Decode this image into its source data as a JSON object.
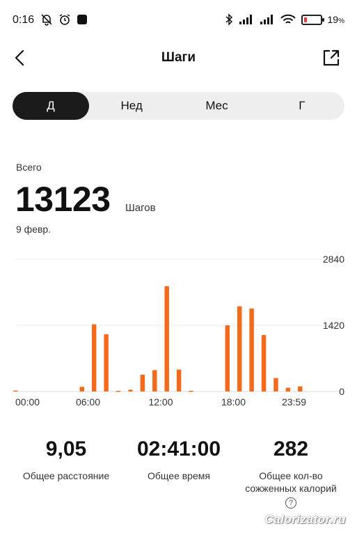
{
  "status_bar": {
    "time": "0:16",
    "battery_percent": "19",
    "battery_symbol": "%",
    "battery_level": 0.19
  },
  "header": {
    "title": "Шаги"
  },
  "tabs": [
    {
      "label": "Д",
      "active": true
    },
    {
      "label": "Нед",
      "active": false
    },
    {
      "label": "Мес",
      "active": false
    },
    {
      "label": "Г",
      "active": false
    }
  ],
  "summary": {
    "total_label": "Всего",
    "total_value": "13123",
    "unit": "Шагов",
    "date": "9 февр."
  },
  "chart_data": {
    "type": "bar",
    "x_tick_labels": [
      "00:00",
      "06:00",
      "12:00",
      "18:00",
      "23:59"
    ],
    "y_tick_labels": [
      "2840",
      "1420",
      "0"
    ],
    "ylim": [
      0,
      2840
    ],
    "grid": true,
    "color": "#f26b1d",
    "bars": [
      {
        "hour": 0,
        "value": 20
      },
      {
        "hour": 5.5,
        "value": 100
      },
      {
        "hour": 6.5,
        "value": 1440
      },
      {
        "hour": 7.5,
        "value": 1230
      },
      {
        "hour": 8.5,
        "value": 15
      },
      {
        "hour": 9.5,
        "value": 40
      },
      {
        "hour": 10.5,
        "value": 360
      },
      {
        "hour": 11.5,
        "value": 460
      },
      {
        "hour": 12.5,
        "value": 2260
      },
      {
        "hour": 13.5,
        "value": 470
      },
      {
        "hour": 14.5,
        "value": 15
      },
      {
        "hour": 17.5,
        "value": 1420
      },
      {
        "hour": 18.5,
        "value": 1830
      },
      {
        "hour": 19.5,
        "value": 1780
      },
      {
        "hour": 20.5,
        "value": 1210
      },
      {
        "hour": 21.5,
        "value": 290
      },
      {
        "hour": 22.5,
        "value": 80
      },
      {
        "hour": 23.5,
        "value": 110
      }
    ]
  },
  "stats": {
    "distance": {
      "value": "9,05",
      "label": "Общее расстояние"
    },
    "time": {
      "value": "02:41:00",
      "label": "Общее время"
    },
    "calories": {
      "value": "282",
      "label_line1": "Общее кол-во",
      "label_line2": "сожженных калорий",
      "help": "?"
    }
  },
  "watermark": "Calorizator.ru",
  "icons": {
    "back": "chevron-left-icon",
    "share": "share-external-icon"
  }
}
